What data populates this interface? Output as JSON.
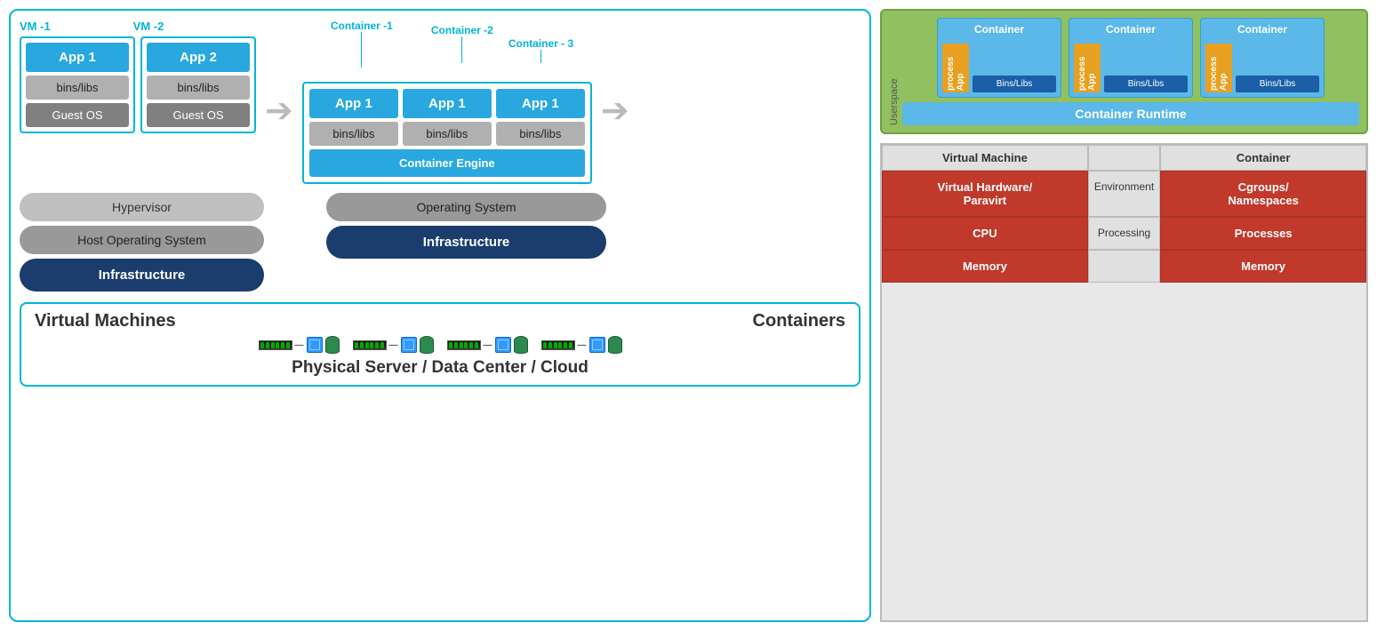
{
  "left_panel": {
    "vm1": {
      "label": "VM -1",
      "app": "App 1",
      "bins": "bins/libs",
      "guestos": "Guest OS"
    },
    "vm2": {
      "label": "VM -2",
      "app": "App 2",
      "bins": "bins/libs",
      "guestos": "Guest OS"
    },
    "containers": {
      "label1": "Container -1",
      "label2": "Container -2",
      "label3": "Container - 3",
      "items": [
        {
          "app": "App 1",
          "bins": "bins/libs"
        },
        {
          "app": "App 1",
          "bins": "bins/libs"
        },
        {
          "app": "App 1",
          "bins": "bins/libs"
        }
      ],
      "engine": "Container Engine"
    },
    "hypervisor": "Hypervisor",
    "host_os": "Host Operating System",
    "infrastructure": "Infrastructure",
    "os": "Operating System",
    "infra2": "Infrastructure",
    "bottom": {
      "vm_title": "Virtual Machines",
      "containers_title": "Containers",
      "footer": "Physical Server / Data Center / Cloud"
    }
  },
  "right_panel": {
    "runtime": {
      "userspace": "Userspace",
      "containers": [
        {
          "label": "Container",
          "app_process": "App process",
          "bins_libs": "Bins/Libs"
        },
        {
          "label": "Container",
          "app_process": "App process",
          "bins_libs": "Bins/Libs"
        },
        {
          "label": "Container",
          "app_process": "App process",
          "bins_libs": "Bins/Libs"
        }
      ],
      "runtime_label": "Container Runtime"
    },
    "comparison": {
      "col1_header": "Virtual Machine",
      "col2_header": "Container",
      "rows": [
        {
          "left": "Virtual Hardware/\nParavirt",
          "mid": "Environment",
          "right": "Cgroups/\nNamespaces"
        },
        {
          "left": "CPU",
          "mid": "Processing",
          "right": "Processes"
        },
        {
          "left": "Memory",
          "mid": "",
          "right": "Memory"
        }
      ]
    }
  },
  "colors": {
    "cyan": "#00b4d8",
    "blue": "#29a8e0",
    "dark_blue": "#1a3d6e",
    "green": "#90c060",
    "orange": "#e8a020",
    "red": "#c0392b"
  }
}
